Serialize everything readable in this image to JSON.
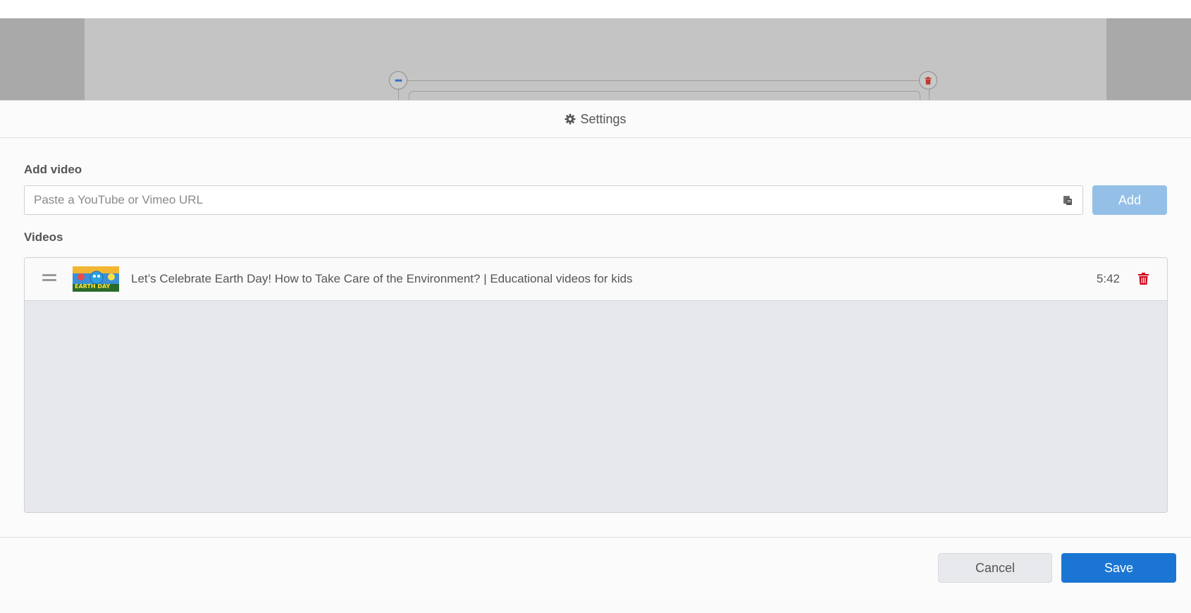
{
  "backdrop": {
    "more_icon": "ellipsis-icon",
    "delete_icon": "trash-icon"
  },
  "modal": {
    "header": {
      "icon": "gear-icon",
      "title": "Settings"
    },
    "add_video": {
      "label": "Add video",
      "placeholder": "Paste a YouTube or Vimeo URL",
      "value": "",
      "paste_icon": "clipboard-icon",
      "add_label": "Add"
    },
    "videos": {
      "label": "Videos",
      "items": [
        {
          "title": "Let’s Celebrate Earth Day! How to Take Care of the Environment? | Educational videos for kids",
          "duration": "5:42",
          "thumbnail_text": "EARTH DAY"
        }
      ]
    },
    "footer": {
      "cancel_label": "Cancel",
      "save_label": "Save"
    }
  },
  "colors": {
    "primary": "#1a76d2",
    "primary_disabled": "#94c0e8",
    "danger": "#d0021b",
    "list_background": "#e6e8eb"
  }
}
